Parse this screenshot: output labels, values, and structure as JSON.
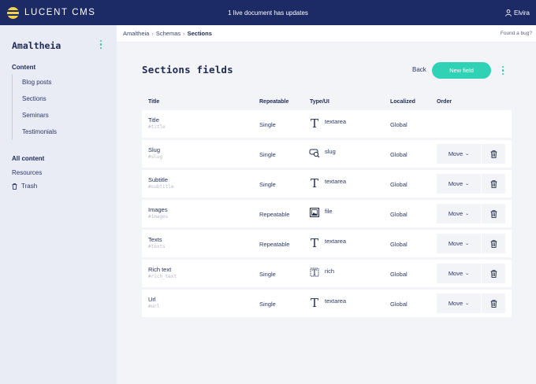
{
  "app": {
    "name": "LUCENT CMS",
    "notice": "1 live document has updates",
    "user": "Elvira"
  },
  "sidebar": {
    "project": "Amaltheia",
    "content_heading": "Content",
    "items": [
      {
        "label": "Blog posts"
      },
      {
        "label": "Sections"
      },
      {
        "label": "Seminars"
      },
      {
        "label": "Testimonials"
      }
    ],
    "all_content": "All content",
    "resources": "Resources",
    "trash": "Trash"
  },
  "breadcrumb": {
    "items": [
      "Amaltheia",
      "Schemas",
      "Sections"
    ],
    "found_bug": "Found a bug?"
  },
  "page": {
    "title": "Sections fields",
    "back_label": "Back",
    "new_field_label": "New field"
  },
  "table": {
    "headers": {
      "title": "Title",
      "repeatable": "Repeatable",
      "type": "Type/UI",
      "localized": "Localized",
      "order": "Order"
    },
    "rows": [
      {
        "name": "Title",
        "key": "#title",
        "repeatable": "Single",
        "type": "textarea",
        "icon": "text-type-icon",
        "localized": "Global",
        "movable": false
      },
      {
        "name": "Slug",
        "key": "#slug",
        "repeatable": "Single",
        "type": "slug",
        "icon": "slug-type-icon",
        "localized": "Global",
        "movable": true
      },
      {
        "name": "Subtitle",
        "key": "#subtitle",
        "repeatable": "Single",
        "type": "textarea",
        "icon": "text-type-icon",
        "localized": "Global",
        "movable": true
      },
      {
        "name": "Images",
        "key": "#images",
        "repeatable": "Repeatable",
        "type": "file",
        "icon": "image-type-icon",
        "localized": "Global",
        "movable": true
      },
      {
        "name": "Texts",
        "key": "#texts",
        "repeatable": "Repeatable",
        "type": "textarea",
        "icon": "text-type-icon",
        "localized": "Global",
        "movable": true
      },
      {
        "name": "Rich text",
        "key": "#rich_text",
        "repeatable": "Single",
        "type": "rich",
        "icon": "rich-type-icon",
        "localized": "Global",
        "movable": true
      },
      {
        "name": "Url",
        "key": "#url",
        "repeatable": "Single",
        "type": "textarea",
        "icon": "text-type-icon",
        "localized": "Global",
        "movable": true
      }
    ],
    "move_label": "Move"
  },
  "colors": {
    "topbar": "#1c2a66",
    "accent": "#2fd2b4",
    "text": "#1e2a55"
  }
}
